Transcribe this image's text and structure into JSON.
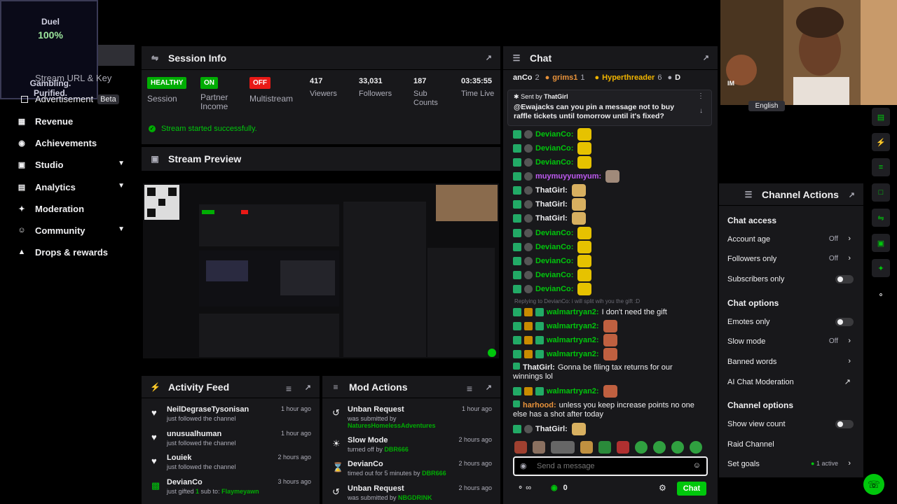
{
  "logo": {
    "line1": "Duel",
    "line2": "100%",
    "line3": "Gambling.",
    "line4": "Purified."
  },
  "sidebar": {
    "stream_url": "Stream URL & Key",
    "advertisement": "Advertisement",
    "beta": "Beta",
    "items": [
      {
        "label": "Revenue",
        "icon": "revenue-icon"
      },
      {
        "label": "Achievements",
        "icon": "trophy-icon"
      },
      {
        "label": "Studio",
        "icon": "studio-icon"
      },
      {
        "label": "Analytics",
        "icon": "analytics-icon"
      },
      {
        "label": "Moderation",
        "icon": "wrench-icon"
      },
      {
        "label": "Community",
        "icon": "community-icon"
      },
      {
        "label": "Drops & rewards",
        "icon": "drops-icon"
      }
    ]
  },
  "session": {
    "title": "Session Info",
    "stats": [
      {
        "badge": "HEALTHY",
        "label": "Session"
      },
      {
        "badge": "ON",
        "label": "Partner Income"
      },
      {
        "badge": "OFF",
        "label": "Multistream"
      },
      {
        "value": "417",
        "label": "Viewers"
      },
      {
        "value": "33,031",
        "label": "Followers"
      },
      {
        "value": "187",
        "label": "Sub Counts"
      },
      {
        "value": "03:35:55",
        "label": "Time Live"
      }
    ],
    "status": "Stream started successfully."
  },
  "preview": {
    "title": "Stream Preview"
  },
  "activity": {
    "title": "Activity Feed",
    "items": [
      {
        "name": "NeilDegraseTysonisan",
        "sub": "just followed the channel",
        "time": "1 hour ago",
        "icon": "heart-icon"
      },
      {
        "name": "unusualhuman",
        "sub": "just followed the channel",
        "time": "1 hour ago",
        "icon": "heart-icon"
      },
      {
        "name": "Louiek",
        "sub": "just followed the channel",
        "time": "2 hours ago",
        "icon": "heart-icon"
      },
      {
        "name": "DevianCo",
        "sub_pre": "just gifted ",
        "sub_num": "1",
        "sub_mid": " sub to: ",
        "sub_user": "Flaymeyawn",
        "time": "3 hours ago",
        "icon": "gift-icon"
      }
    ]
  },
  "mod": {
    "title": "Mod Actions",
    "items": [
      {
        "name": "Unban Request",
        "sub": "was submitted by",
        "user": "NaturesHomelessAdventures",
        "time": "1 hour ago",
        "icon": "undo-icon"
      },
      {
        "name": "Slow Mode",
        "sub": "turned off by",
        "user": "DBR666",
        "time": "2 hours ago",
        "icon": "slow-icon"
      },
      {
        "name": "DevianCo",
        "sub": "timed out for 5 minutes by",
        "user": "DBR666",
        "time": "2 hours ago",
        "icon": "hourglass-icon"
      },
      {
        "name": "Unban Request",
        "sub": "was submitted by",
        "user": "NBGDRINK",
        "time": "2 hours ago",
        "icon": "undo-icon"
      }
    ]
  },
  "chat": {
    "title": "Chat",
    "top_bar": [
      {
        "name": "anCo",
        "count": "2"
      },
      {
        "name": "grims1",
        "count": "1"
      },
      {
        "name": "Hyperthreader",
        "count": "6"
      },
      {
        "name": "D",
        "count": ""
      }
    ],
    "pinned": {
      "sent_by_label": "Sent by",
      "sent_by": "ThatGirl",
      "text": "@Ewajacks can you pin a message not to buy raffle tickets until tomorrow until it's fixed?"
    },
    "reply_hint": "Replying to DevianCo: i will split wih you the gift :D",
    "messages": [
      {
        "user": "DevianCo:",
        "text": "",
        "color": "#00c70c",
        "emote": "#e6c200"
      },
      {
        "user": "DevianCo:",
        "text": "",
        "color": "#00c70c",
        "emote": "#e6c200"
      },
      {
        "user": "DevianCo:",
        "text": "",
        "color": "#00c70c",
        "emote": "#e6c200"
      },
      {
        "user": "muymuyyumyum:",
        "text": "",
        "color": "#bf5af2",
        "emote": "#a08a7a"
      },
      {
        "user": "ThatGirl:",
        "text": "",
        "color": "#efeff1",
        "emote": "#d8b060"
      },
      {
        "user": "ThatGirl:",
        "text": "",
        "color": "#efeff1",
        "emote": "#d8b060"
      },
      {
        "user": "ThatGirl:",
        "text": "",
        "color": "#efeff1",
        "emote": "#d8b060"
      },
      {
        "user": "DevianCo:",
        "text": "",
        "color": "#00c70c",
        "emote": "#e6c200"
      },
      {
        "user": "DevianCo:",
        "text": "",
        "color": "#00c70c",
        "emote": "#e6c200"
      },
      {
        "user": "DevianCo:",
        "text": "",
        "color": "#00c70c",
        "emote": "#e6c200"
      },
      {
        "user": "DevianCo:",
        "text": "",
        "color": "#00c70c",
        "emote": "#e6c200"
      },
      {
        "user": "DevianCo:",
        "text": "",
        "color": "#00c70c",
        "emote": "#e6c200"
      }
    ],
    "messages2": [
      {
        "user": "walmartryan2:",
        "text": "I don't need the gift",
        "color": "#00c70c",
        "emote": ""
      },
      {
        "user": "walmartryan2:",
        "text": "",
        "color": "#00c70c",
        "emote": "#c06040"
      },
      {
        "user": "walmartryan2:",
        "text": "",
        "color": "#00c70c",
        "emote": "#c06040"
      },
      {
        "user": "walmartryan2:",
        "text": "",
        "color": "#00c70c",
        "emote": "#c06040"
      }
    ],
    "thatgirl_long_user": "ThatGirl:",
    "thatgirl_long": "Gonna be filing tax returns for our winnings lol",
    "walmart_last": "walmartryan2:",
    "harhood_user": "harhood:",
    "harhood_text": "unless you keep increase points no one else has a shot after today",
    "thatgirl_last": "ThatGirl:",
    "input_placeholder": "Send a message",
    "points": "0",
    "send_label": "Chat"
  },
  "webcam": {
    "lang": "English",
    "tag": "IM"
  },
  "actions": {
    "title": "Channel Actions",
    "chat_access": "Chat access",
    "account_age": "Account age",
    "account_age_val": "Off",
    "followers_only": "Followers only",
    "followers_only_val": "Off",
    "subscribers_only": "Subscribers only",
    "chat_options": "Chat options",
    "emotes_only": "Emotes only",
    "slow_mode": "Slow mode",
    "slow_mode_val": "Off",
    "banned_words": "Banned words",
    "ai_mod": "AI Chat Moderation",
    "channel_options": "Channel options",
    "show_view_count": "Show view count",
    "raid_channel": "Raid Channel",
    "set_goals": "Set goals",
    "set_goals_val": "1 active"
  },
  "colors": {
    "accent": "#00c70c",
    "panel": "#18181b",
    "off_badge": "#e91916",
    "on_badge": "#00ad03"
  }
}
